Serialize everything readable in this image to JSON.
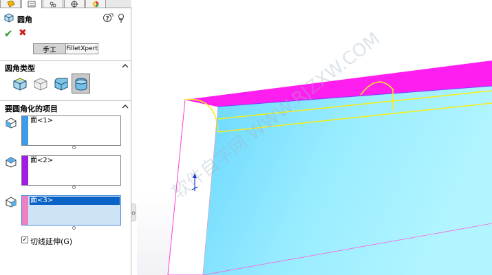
{
  "tabs": [
    {
      "name": "feature-manager-tab",
      "icon": "feature-tree-icon"
    },
    {
      "name": "property-manager-tab",
      "icon": "property-list-icon"
    },
    {
      "name": "configuration-manager-tab",
      "icon": "configuration-icon"
    },
    {
      "name": "dimxpert-tab",
      "icon": "crosshair-icon"
    },
    {
      "name": "display-manager-tab",
      "icon": "color-wheel-icon"
    }
  ],
  "property_manager": {
    "title": "圆角",
    "mode_tabs": {
      "manual": "手工",
      "xpert": "FilletXpert"
    }
  },
  "sections": {
    "fillet_type": "圆角类型",
    "items": "要圆角化的项目"
  },
  "selection_lists": [
    {
      "value": "面<1>",
      "color": "#3d9be9"
    },
    {
      "value": "面<2>",
      "color": "#a21ce6"
    },
    {
      "value": "面<3>",
      "color": "#f07ec4"
    }
  ],
  "tangent_propagation": {
    "label": "切线延伸(G)",
    "checked": true
  },
  "watermark": "软件自学网 WWW.RJZXW.COM",
  "colors": {
    "accent_selection": "#0b63c5",
    "model_face_blue": "#8ee8ff",
    "model_face_magenta": "#ff1ef0",
    "preview_edges": "#f5ee1a"
  }
}
